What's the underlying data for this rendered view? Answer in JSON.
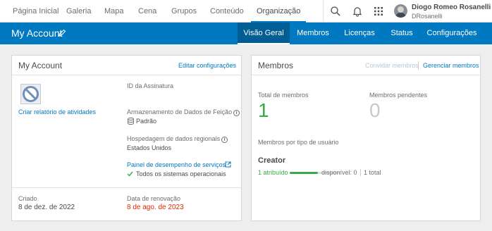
{
  "topnav": {
    "items": [
      "Página Inicial",
      "Galeria",
      "Mapa",
      "Cena",
      "Grupos",
      "Conteúdo",
      "Organização"
    ],
    "active": "Organização",
    "icons": [
      "search-icon",
      "bell-icon",
      "apps-grid-icon"
    ],
    "user": {
      "name": "Diogo Romeo Rosanelli",
      "handle": "DRosanelli"
    }
  },
  "subheader": {
    "title": "My Account",
    "tabs": [
      "Visão Geral",
      "Membros",
      "Licenças",
      "Status",
      "Configurações"
    ],
    "active_tab": "Visão Geral"
  },
  "account": {
    "title": "My Account",
    "edit_link": "Editar configurações",
    "activity_link": "Criar relatório de atividades",
    "subscription_label": "ID da Assinatura",
    "storage_label": "Armazenamento de Dados de Feição",
    "storage_value": "Padrão",
    "hosting_label": "Hospedagem de dados regionais",
    "hosting_value": "Estados Unidos",
    "dashboard_link": "Painel de desempenho de serviços",
    "status_text": "Todos os sistemas operacionais",
    "created_label": "Criado",
    "created_value": "8 de dez. de 2022",
    "renewal_label": "Data de renovação",
    "renewal_value": "8 de ago. de 2023"
  },
  "members": {
    "title": "Membros",
    "invite_link": "Convidar membros",
    "manage_link": "Gerenciar membros",
    "total_label": "Total de membros",
    "total_value": "1",
    "pending_label": "Membros pendentes",
    "pending_value": "0",
    "by_type_label": "Membros por tipo de usuário",
    "type_name": "Creator",
    "assigned_text": "1 atribuído",
    "assigned_fraction": 1,
    "available_text": "disponível: 0",
    "total_text": "1 total"
  },
  "colors": {
    "brand_blue": "#0079c1",
    "success_green": "#35ac46",
    "renewal_red": "#de2900"
  }
}
